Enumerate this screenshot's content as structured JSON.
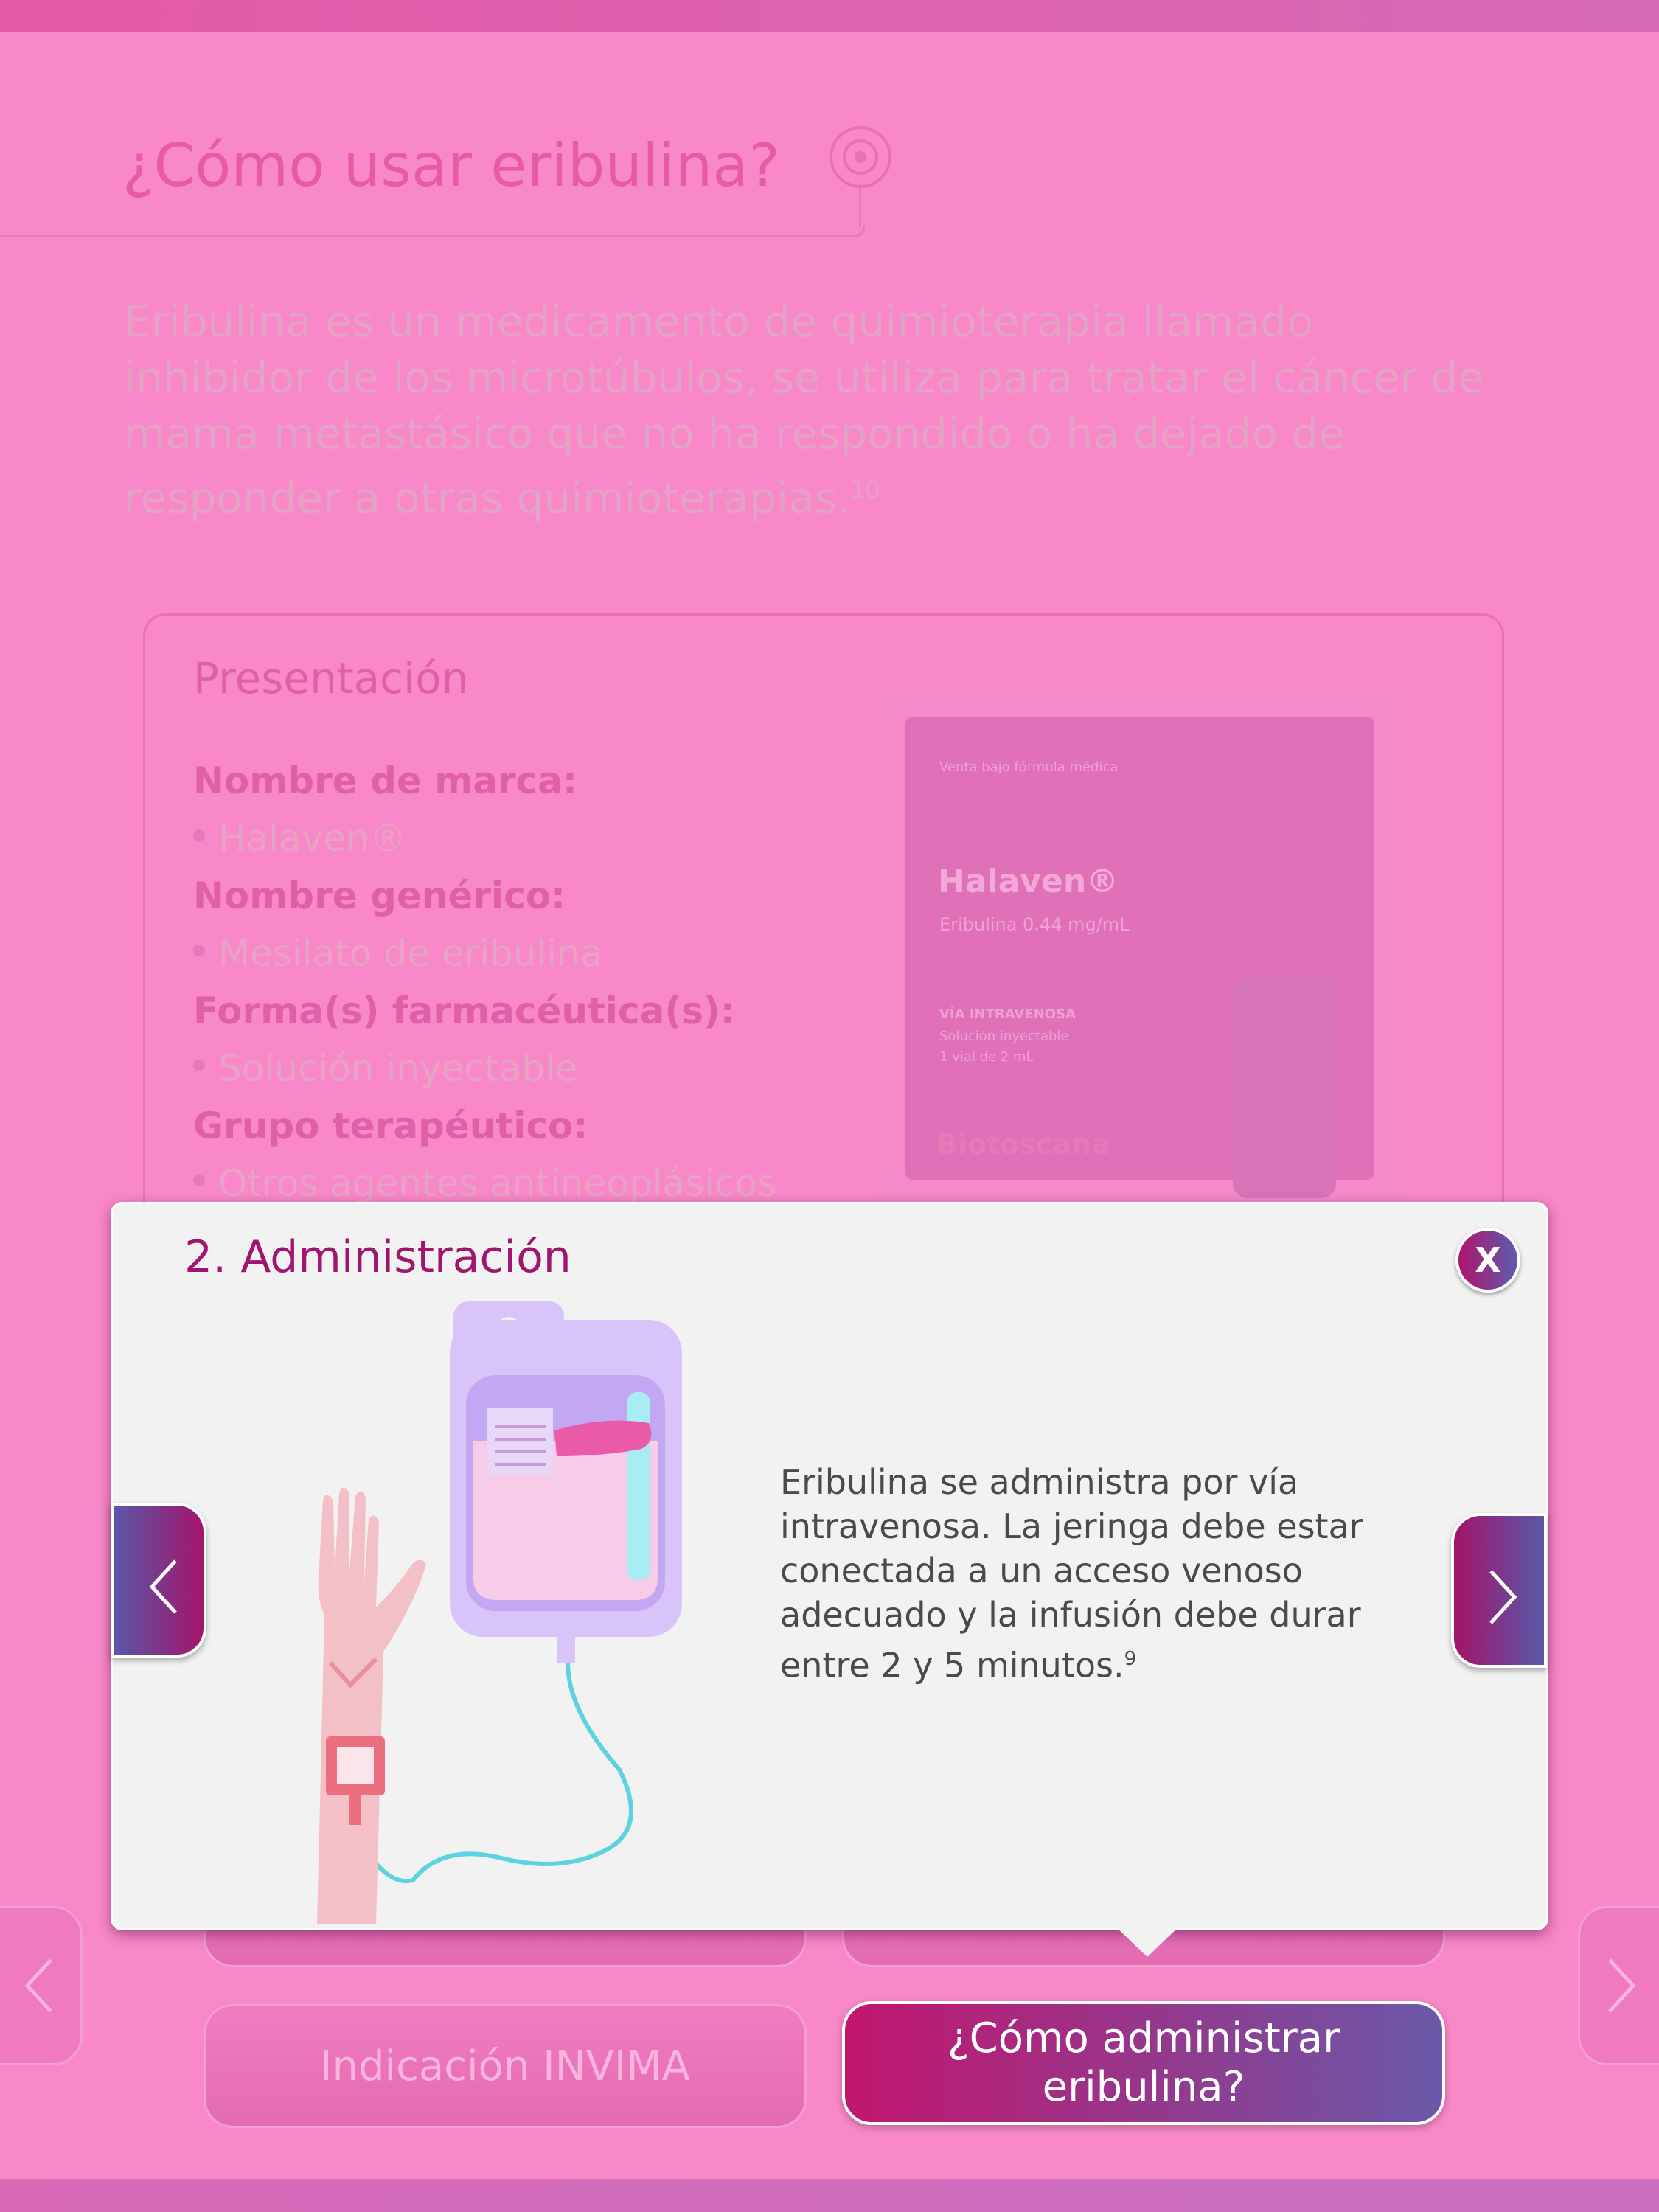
{
  "page": {
    "title": "¿Cómo usar eribulina?",
    "intro": "Eribulina es un medicamento de quimioterapia llamado inhibidor de los microtúbulos, se utiliza para tratar el cáncer de mama metastásico que no ha respondido o ha dejado de responder a otras quimioterapias.",
    "intro_ref": "10"
  },
  "presentation": {
    "title": "Presentación",
    "items": [
      {
        "label": "Nombre de marca:",
        "value": "Halaven®"
      },
      {
        "label": "Nombre genérico:",
        "value": "Mesilato de eribulina"
      },
      {
        "label": "Forma(s) farmacéutica(s):",
        "value": "Solución inyectable"
      },
      {
        "label": "Grupo terapéutico:",
        "value": "Otros agentes antineoplásicos"
      }
    ],
    "product": {
      "box_note": "Venta bajo fórmula médica",
      "brand": "Halaven®",
      "concentration": "Eribulina 0.44 mg/mL",
      "route": "VÍA INTRAVENOSA",
      "form": "Solución inyectable",
      "vial": "1 vial de 2 mL",
      "lab": "Biotoscana"
    }
  },
  "modal": {
    "title": "2. Administración",
    "close_label": "X",
    "text": "Eribulina se administra por vía intravenosa. La jeringa debe estar conectada a un acceso venoso adecuado y la infusión debe durar entre 2 y 5 minutos.",
    "text_ref": "9"
  },
  "nav": {
    "buttons": [
      {
        "label": "Indicación INVIMA"
      },
      {
        "label": "¿Cómo administrar eribulina?"
      }
    ]
  },
  "colors": {
    "background": "#f888c8",
    "accent": "#a0156e",
    "gradient_end": "#5c5cae"
  }
}
